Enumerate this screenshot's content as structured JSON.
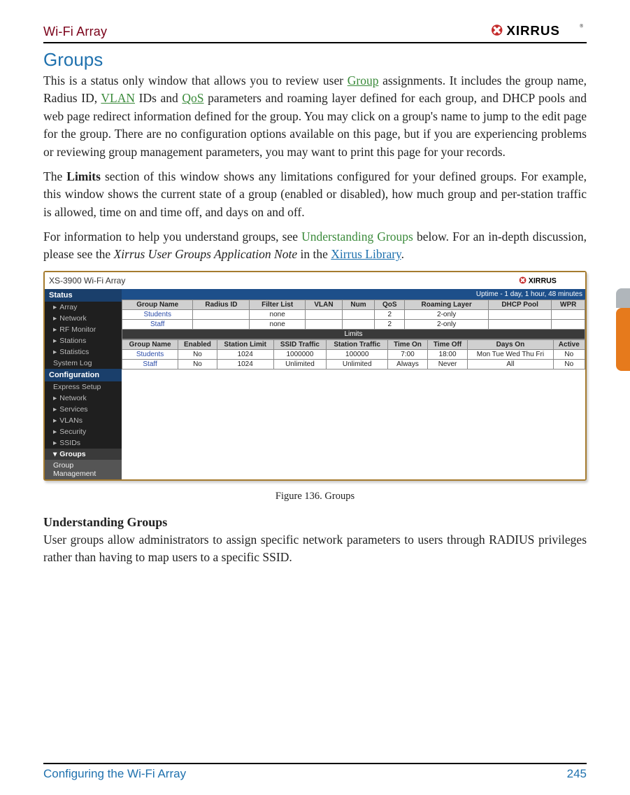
{
  "header": {
    "product": "Wi-Fi Array",
    "logo_text": "XIRRUS"
  },
  "section": {
    "title": "Groups"
  },
  "para1": {
    "seg1": "This is a status only window that allows you to review user ",
    "link1": "Group",
    "seg2": " assignments. It includes the group name, Radius ID, ",
    "link2": "VLAN",
    "seg3": " IDs and ",
    "link3": "QoS",
    "seg4": " parameters and roaming layer defined for each group, and DHCP pools and web page redirect information defined for the group. You may click on a group's name to jump to the edit page for the group. There are no configuration options available on this page, but if you are experiencing problems or reviewing group management parameters, you may want to print this page for your records."
  },
  "para2": {
    "seg1": "The ",
    "bold1": "Limits",
    "seg2": " section of this window shows any limitations configured for your defined groups. For example, this window shows the current state of a group (enabled or disabled), how much group and per-station traffic is allowed, time on and time off, and days on and off."
  },
  "para3": {
    "seg1": "For information to help you understand groups, see ",
    "link1": "Understanding Groups",
    "seg2": " below. For an in-depth discussion, please see the ",
    "ital1": "Xirrus User Groups Application Note",
    "seg3": " in the ",
    "link2": "Xirrus Library",
    "seg4": "."
  },
  "screenshot": {
    "device_title": "XS-3900 Wi-Fi Array",
    "logo_text": "XIRRUS",
    "uptime": "Uptime - 1 day, 1 hour, 48 minutes",
    "sidebar": {
      "sections": [
        {
          "label": "Status",
          "items": [
            "Array",
            "Network",
            "RF Monitor",
            "Stations",
            "Statistics",
            "System Log"
          ]
        },
        {
          "label": "Configuration",
          "items": [
            "Express Setup",
            "Network",
            "Services",
            "VLANs",
            "Security",
            "SSIDs"
          ]
        }
      ],
      "selected": "Groups",
      "subitem": "Group Management"
    },
    "table1": {
      "headers": [
        "Group Name",
        "Radius ID",
        "Filter List",
        "VLAN",
        "Num",
        "QoS",
        "Roaming Layer",
        "DHCP Pool",
        "WPR"
      ],
      "rows": [
        {
          "name": "Students",
          "radius": "",
          "filter": "none",
          "vlan": "",
          "num": "",
          "qos": "2",
          "roam": "2-only",
          "dhcp": "",
          "wpr": ""
        },
        {
          "name": "Staff",
          "radius": "",
          "filter": "none",
          "vlan": "",
          "num": "",
          "qos": "2",
          "roam": "2-only",
          "dhcp": "",
          "wpr": ""
        }
      ]
    },
    "limits_label": "Limits",
    "table2": {
      "headers": [
        "Group Name",
        "Enabled",
        "Station Limit",
        "SSID Traffic",
        "Station Traffic",
        "Time On",
        "Time Off",
        "Days On",
        "Active"
      ],
      "rows": [
        {
          "name": "Students",
          "en": "No",
          "limit": "1024",
          "ssid": "1000000",
          "station": "100000",
          "ton": "7:00",
          "toff": "18:00",
          "days": "Mon Tue Wed Thu Fri",
          "active": "No"
        },
        {
          "name": "Staff",
          "en": "No",
          "limit": "1024",
          "ssid": "Unlimited",
          "station": "Unlimited",
          "ton": "Always",
          "toff": "Never",
          "days": "All",
          "active": "No"
        }
      ]
    }
  },
  "figure_caption": "Figure 136. Groups",
  "subsection": {
    "title": "Understanding Groups",
    "body": "User groups allow administrators to assign specific network parameters to users through RADIUS privileges rather than having to map users to a specific SSID."
  },
  "footer": {
    "left": "Configuring the Wi-Fi Array",
    "page": "245"
  }
}
